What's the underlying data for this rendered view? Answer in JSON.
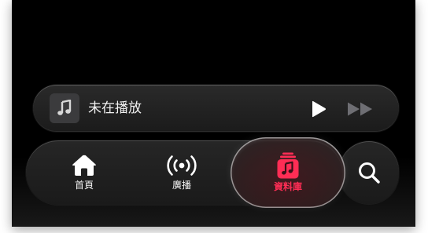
{
  "mini_player": {
    "title": "未在播放",
    "artwork_icon": "music-note-icon",
    "play_icon": "play-icon",
    "forward_icon": "fast-forward-icon"
  },
  "tabs": [
    {
      "label": "首頁",
      "icon": "house-icon",
      "selected": false
    },
    {
      "label": "廣播",
      "icon": "radio-waves-icon",
      "selected": false
    },
    {
      "label": "資料庫",
      "icon": "library-music-icon",
      "selected": true
    }
  ],
  "search": {
    "icon": "magnifier-icon"
  },
  "colors": {
    "accent": "#ff2d55",
    "background": "#000000",
    "text": "#f2f2f2",
    "disabled": "#6e6e73"
  }
}
